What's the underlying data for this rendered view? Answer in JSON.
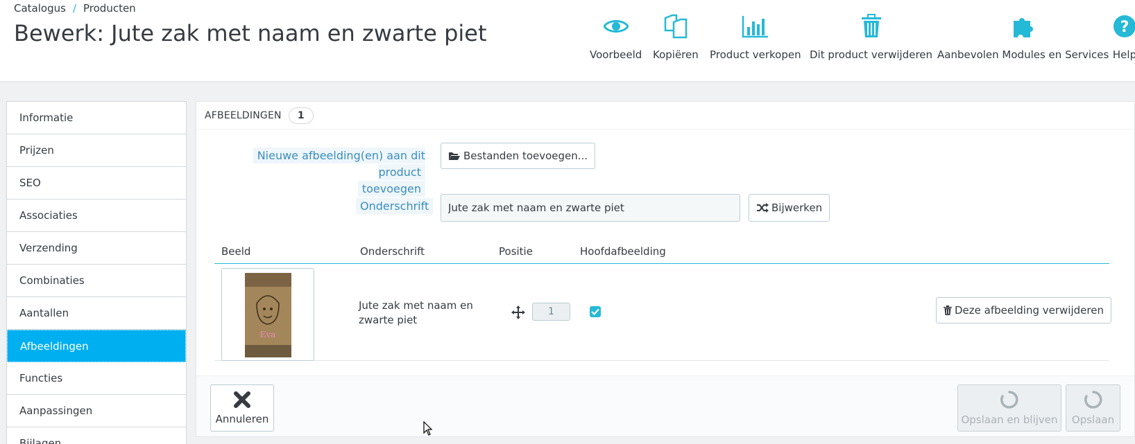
{
  "breadcrumb": {
    "root": "Catalogus",
    "sep": "/",
    "current": "Producten"
  },
  "page_title": "Bewerk: Jute zak met naam en zwarte piet",
  "toolbar": [
    {
      "label": "Voorbeeld",
      "icon": "eye-icon"
    },
    {
      "label": "Kopiëren",
      "icon": "copy-icon"
    },
    {
      "label": "Product verkopen",
      "icon": "bar-chart-icon"
    },
    {
      "label": "Dit product verwijderen",
      "icon": "trash-icon"
    },
    {
      "label": "Aanbevolen Modules en Services",
      "icon": "puzzle-icon"
    },
    {
      "label": "Help",
      "icon": "help-icon"
    }
  ],
  "sidebar": {
    "items": [
      {
        "label": "Informatie"
      },
      {
        "label": "Prijzen"
      },
      {
        "label": "SEO"
      },
      {
        "label": "Associaties"
      },
      {
        "label": "Verzending"
      },
      {
        "label": "Combinaties"
      },
      {
        "label": "Aantallen"
      },
      {
        "label": "Afbeeldingen",
        "active": true
      },
      {
        "label": "Functies"
      },
      {
        "label": "Aanpassingen"
      },
      {
        "label": "Bijlagen"
      }
    ]
  },
  "panel": {
    "title": "AFBEELDINGEN",
    "count": "1",
    "new_images_label_line1": "Nieuwe afbeelding(en) aan dit product",
    "new_images_label_line2": "toevoegen",
    "add_files_button": "Bestanden toevoegen...",
    "caption_label": "Onderschrift",
    "caption_value": "Jute zak met naam en zwarte piet",
    "update_button": "Bijwerken",
    "table": {
      "headers": [
        "Beeld",
        "Onderschrift",
        "Positie",
        "Hoofdafbeelding"
      ],
      "rows": [
        {
          "image_text": "Eva",
          "caption": "Jute zak met naam en zwarte piet",
          "position": "1",
          "is_cover": true,
          "delete_button": "Deze afbeelding verwijderen"
        }
      ]
    },
    "footer": {
      "cancel": "Annuleren",
      "save_stay": "Opslaan en blijven",
      "save": "Opslaan"
    }
  },
  "colors": {
    "accent": "#25b9d7",
    "active_tab": "#00aff0",
    "label_blue": "#3b8dbd"
  }
}
